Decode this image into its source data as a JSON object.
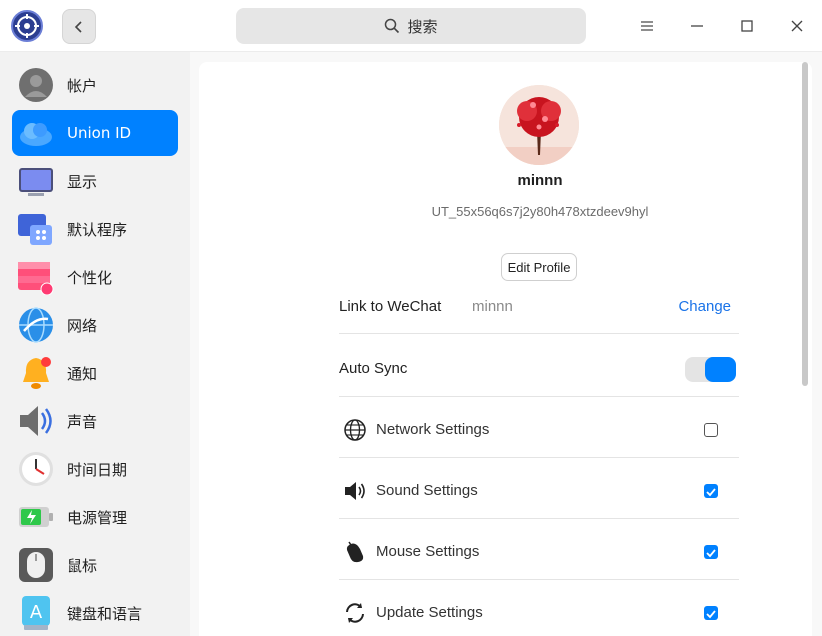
{
  "header": {
    "search_placeholder": "搜索"
  },
  "sidebar": {
    "items": [
      {
        "label": "帐户",
        "icon": "account-icon"
      },
      {
        "label": "Union ID",
        "icon": "cloud-icon",
        "active": true
      },
      {
        "label": "显示",
        "icon": "display-icon"
      },
      {
        "label": "默认程序",
        "icon": "default-apps-icon"
      },
      {
        "label": "个性化",
        "icon": "personalization-icon"
      },
      {
        "label": "网络",
        "icon": "network-icon"
      },
      {
        "label": "通知",
        "icon": "bell-icon"
      },
      {
        "label": "声音",
        "icon": "speaker-icon"
      },
      {
        "label": "时间日期",
        "icon": "clock-icon"
      },
      {
        "label": "电源管理",
        "icon": "battery-icon"
      },
      {
        "label": "鼠标",
        "icon": "mouse-icon"
      },
      {
        "label": "键盘和语言",
        "icon": "keyboard-icon"
      }
    ]
  },
  "profile": {
    "username": "minnn",
    "user_id": "UT_55x56q6s7j2y80h478xtzdeev9hyl",
    "edit_label": "Edit Profile"
  },
  "wechat": {
    "label": "Link to WeChat",
    "value": "minnn",
    "change_label": "Change"
  },
  "auto_sync": {
    "label": "Auto Sync",
    "enabled": true
  },
  "sync_settings": [
    {
      "label": "Network Settings",
      "icon": "globe-icon",
      "checked": false
    },
    {
      "label": "Sound Settings",
      "icon": "speaker-icon",
      "checked": true
    },
    {
      "label": "Mouse Settings",
      "icon": "mouse-icon",
      "checked": true
    },
    {
      "label": "Update Settings",
      "icon": "refresh-icon",
      "checked": true
    }
  ],
  "colors": {
    "accent": "#0081ff",
    "link": "#1a73e8"
  }
}
